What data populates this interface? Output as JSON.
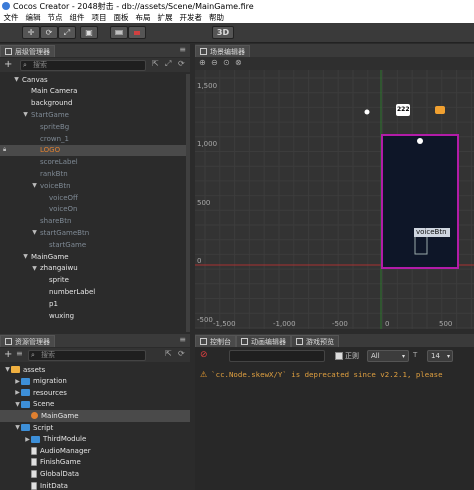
{
  "window": {
    "title": "Cocos Creator - 2048射击 - db://assets/Scene/MainGame.fire"
  },
  "menu": [
    "文件",
    "编辑",
    "节点",
    "组件",
    "项目",
    "面板",
    "布局",
    "扩展",
    "开发者",
    "帮助"
  ],
  "toolbar": {
    "mode_3d_label": "3D"
  },
  "hierarchy": {
    "title": "层级管理器",
    "search_placeholder": "搜索",
    "nodes": [
      {
        "label": "Canvas",
        "indent": 1,
        "arrow": "▼",
        "dim": false
      },
      {
        "label": "Main Camera",
        "indent": 2,
        "arrow": "",
        "dim": false
      },
      {
        "label": "background",
        "indent": 2,
        "arrow": "",
        "dim": false
      },
      {
        "label": "StartGame",
        "indent": 2,
        "arrow": "▼",
        "dim": true
      },
      {
        "label": "spriteBg",
        "indent": 3,
        "arrow": "",
        "dim": true
      },
      {
        "label": "crown_1",
        "indent": 3,
        "arrow": "",
        "dim": true
      },
      {
        "label": "LOGO",
        "indent": 3,
        "arrow": "",
        "dim": true,
        "selected": true,
        "locked": true,
        "color": "#e08030"
      },
      {
        "label": "scoreLabel",
        "indent": 3,
        "arrow": "",
        "dim": true
      },
      {
        "label": "rankBtn",
        "indent": 3,
        "arrow": "",
        "dim": true
      },
      {
        "label": "voiceBtn",
        "indent": 3,
        "arrow": "▼",
        "dim": true
      },
      {
        "label": "voiceOff",
        "indent": 4,
        "arrow": "",
        "dim": true
      },
      {
        "label": "voiceOn",
        "indent": 4,
        "arrow": "",
        "dim": true
      },
      {
        "label": "shareBtn",
        "indent": 3,
        "arrow": "",
        "dim": true
      },
      {
        "label": "startGameBtn",
        "indent": 3,
        "arrow": "▼",
        "dim": true
      },
      {
        "label": "startGame",
        "indent": 4,
        "arrow": "",
        "dim": true
      },
      {
        "label": "MainGame",
        "indent": 2,
        "arrow": "▼",
        "dim": false
      },
      {
        "label": "zhangaiwu",
        "indent": 3,
        "arrow": "▼",
        "dim": false
      },
      {
        "label": "sprite",
        "indent": 4,
        "arrow": "",
        "dim": false
      },
      {
        "label": "numberLabel",
        "indent": 4,
        "arrow": "",
        "dim": false
      },
      {
        "label": "p1",
        "indent": 4,
        "arrow": "",
        "dim": false
      },
      {
        "label": "wuxing",
        "indent": 4,
        "arrow": "",
        "dim": false
      }
    ]
  },
  "assets": {
    "title": "资源管理器",
    "search_placeholder": "搜索",
    "items": [
      {
        "label": "assets",
        "indent": 0,
        "arrow": "▼",
        "kind": "db"
      },
      {
        "label": "migration",
        "indent": 1,
        "arrow": "▶",
        "kind": "folder"
      },
      {
        "label": "resources",
        "indent": 1,
        "arrow": "▶",
        "kind": "folder"
      },
      {
        "label": "Scene",
        "indent": 1,
        "arrow": "▼",
        "kind": "folder"
      },
      {
        "label": "MainGame",
        "indent": 2,
        "arrow": "",
        "kind": "scene",
        "selected": true
      },
      {
        "label": "Script",
        "indent": 1,
        "arrow": "▼",
        "kind": "folder"
      },
      {
        "label": "ThirdModule",
        "indent": 2,
        "arrow": "▶",
        "kind": "folder"
      },
      {
        "label": "AudioManager",
        "indent": 2,
        "arrow": "",
        "kind": "script"
      },
      {
        "label": "FinishGame",
        "indent": 2,
        "arrow": "",
        "kind": "script"
      },
      {
        "label": "GlobalData",
        "indent": 2,
        "arrow": "",
        "kind": "script"
      },
      {
        "label": "InitData",
        "indent": 2,
        "arrow": "",
        "kind": "script"
      }
    ]
  },
  "scene": {
    "title": "场景编辑器",
    "y_ticks": [
      "1,500",
      "1,000",
      "500",
      "0",
      "-500"
    ],
    "x_ticks": [
      "-1,500",
      "-1,000",
      "-500",
      "0",
      "500"
    ],
    "counter_badge": "222",
    "node_label": "voiceBtn"
  },
  "console": {
    "tabs": [
      "控制台",
      "动画编辑器",
      "游戏预览"
    ],
    "regex_label": "正则",
    "level": "All",
    "font_size": "14",
    "message": "`cc.Node.skewX/Y` is deprecated since v2.2.1, please"
  },
  "colors": {
    "accent": "#b21ca8",
    "warning": "#f0a030",
    "axis_red": "#a83232"
  }
}
